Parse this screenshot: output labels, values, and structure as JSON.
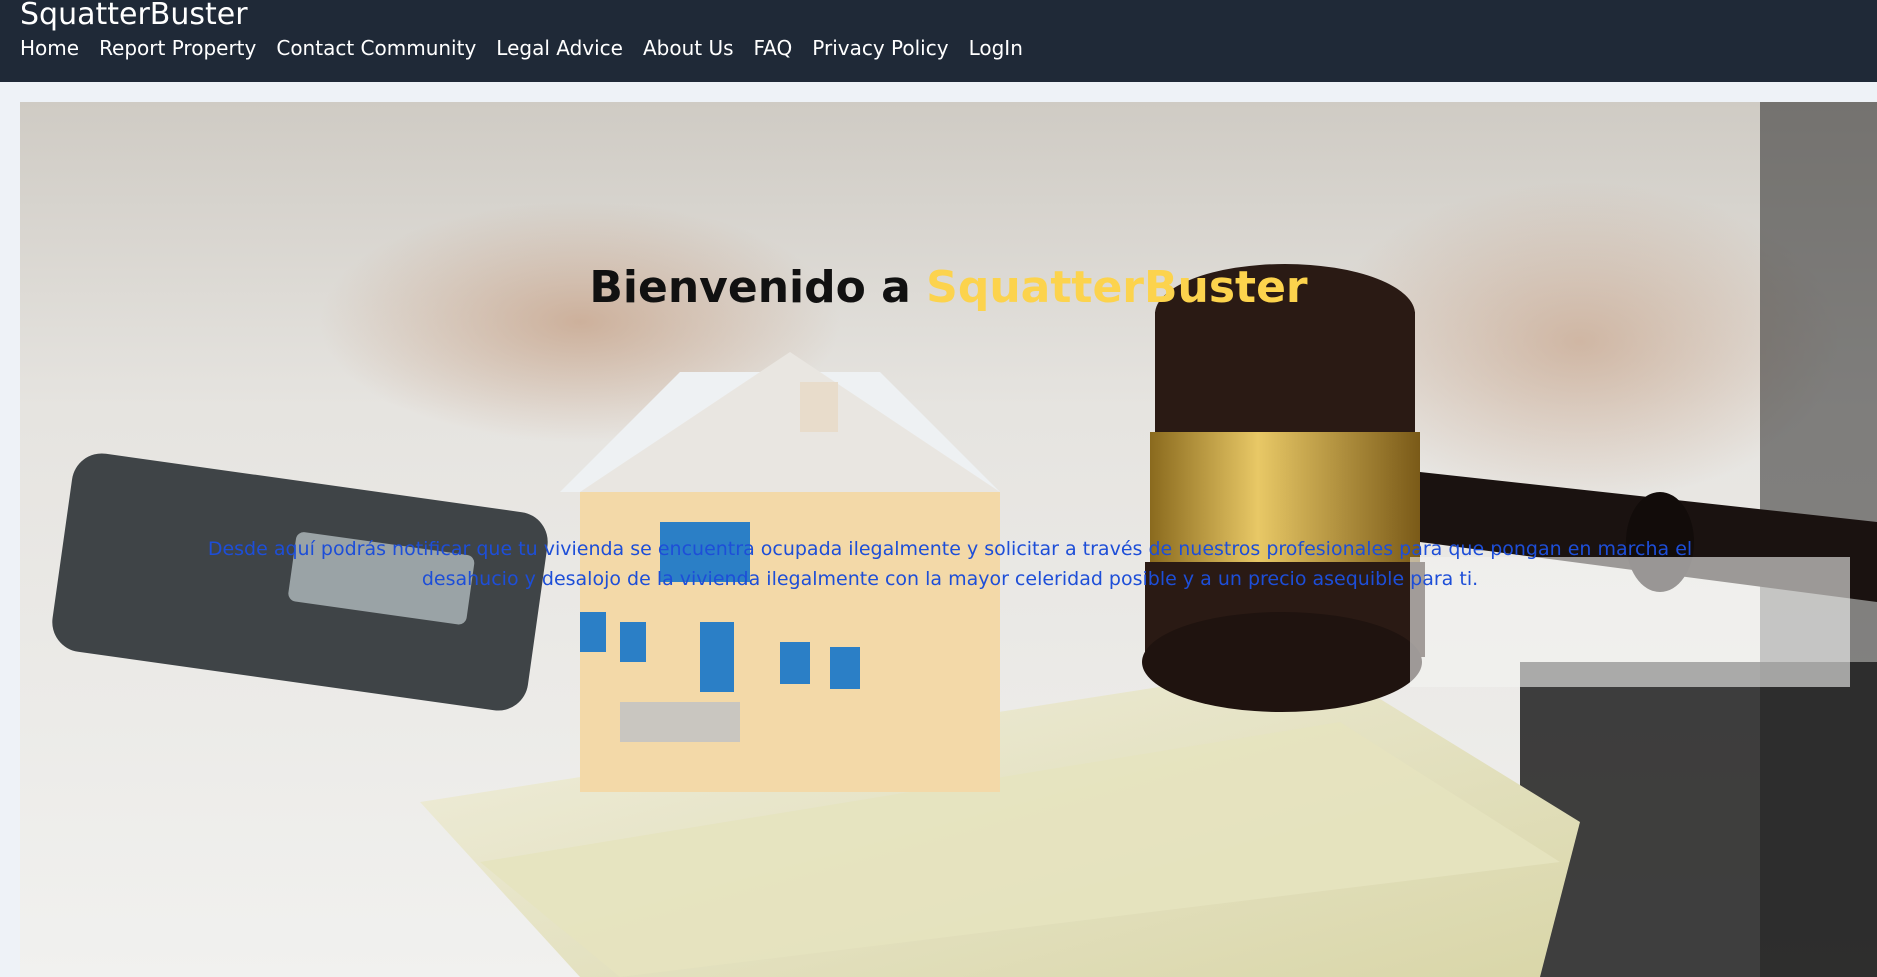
{
  "navbar": {
    "brand": "SquatterBuster",
    "links": [
      {
        "label": "Home"
      },
      {
        "label": "Report Property"
      },
      {
        "label": "Contact Community"
      },
      {
        "label": "Legal Advice"
      },
      {
        "label": "About Us"
      },
      {
        "label": "FAQ"
      },
      {
        "label": "Privacy Policy"
      },
      {
        "label": "LogIn"
      }
    ]
  },
  "hero": {
    "title_prefix": "Bienvenido a ",
    "title_brand": "SquatterBuster",
    "description": "Desde aquí podrás notificar que tu vivienda se encuentra ocupada ilegalmente y solicitar a través de nuestros profesionales para que pongan en marcha el desahucio y desalojo de la vivienda ilegalmente con la mayor celeridad posible y a un precio asequible para ti.",
    "image": "house-gavel-money-photo"
  },
  "colors": {
    "navbar_bg": "#1f2937",
    "accent": "#fcd34d",
    "description_text": "#1d4ed8"
  }
}
